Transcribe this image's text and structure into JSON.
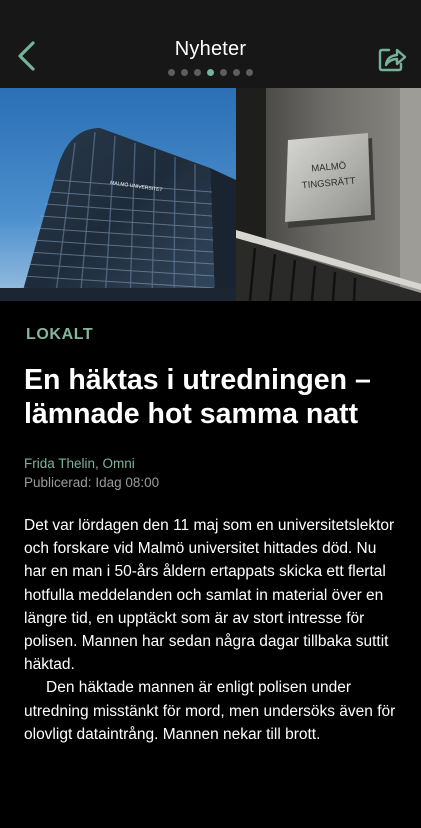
{
  "header": {
    "title": "Nyheter",
    "back_icon": "chevron-left-icon",
    "share_icon": "share-icon",
    "pager": {
      "count": 7,
      "active": 4
    },
    "accent_color": "#74b39a"
  },
  "hero": {
    "left_image": "modern glass office building against blue sky",
    "right_image": "wall sign",
    "sign_line1": "MALMÖ",
    "sign_line2": "TINGSRÄTT",
    "building_sign": "MALMÖ UNIVERSITET"
  },
  "article": {
    "category": "LOKALT",
    "headline": "En häktas i utredningen – lämnade hot samma natt",
    "author": "Frida Thelin, Omni",
    "published_label": "Publicerad:",
    "published_value": "Idag 08:00",
    "paragraphs": [
      "Det var lördagen den 11 maj som en universitetslektor och forskare vid Malmö universitet hittades död. Nu har en man i 50-års åldern ertappats skicka ett flertal hotfulla meddelanden och samlat in material över en längre tid, en upptäckt som är av stort intresse för polisen. Mannen har sedan några dagar tillbaka suttit häktad.",
      "Den häktade mannen är enligt polisen under utredning misstänkt för mord, men undersöks även för olovligt dataintrång. Mannen nekar till brott."
    ]
  }
}
